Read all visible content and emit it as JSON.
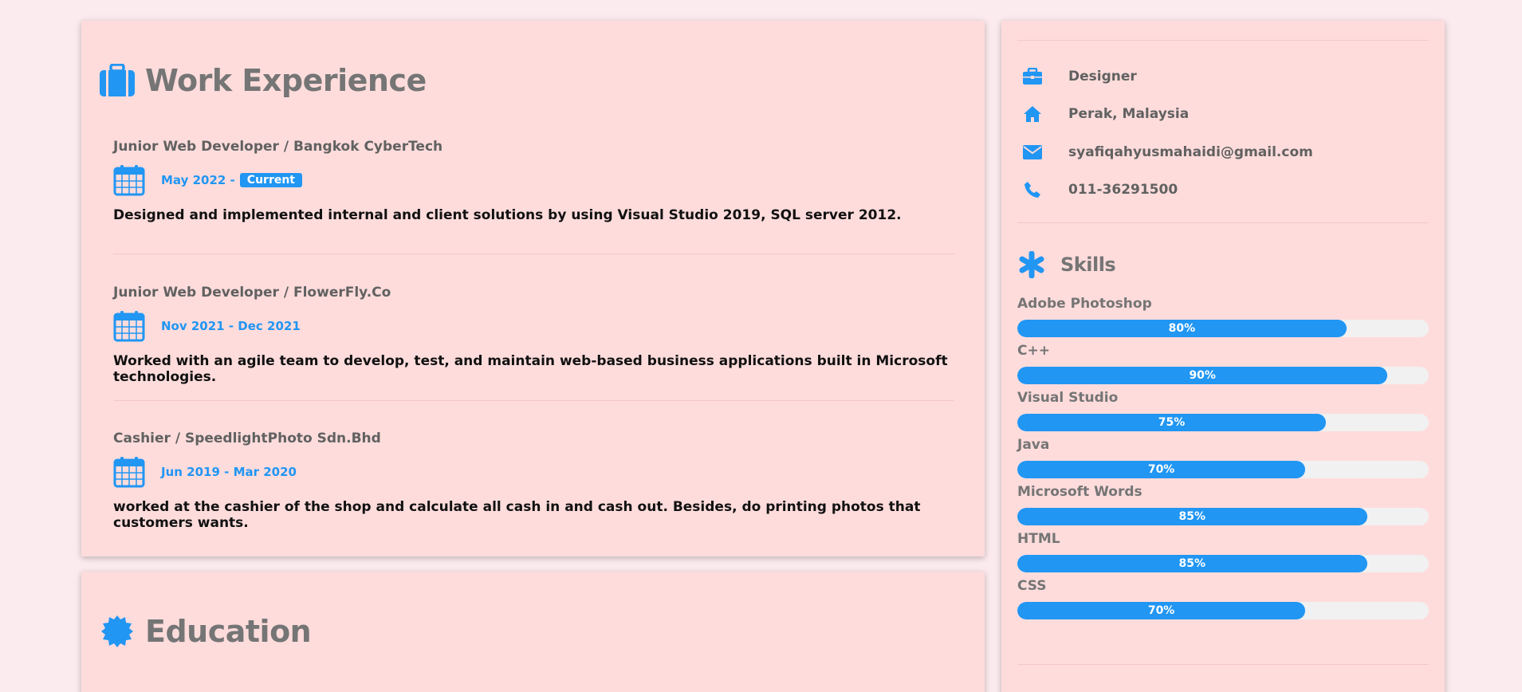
{
  "work": {
    "title": "Work Experience",
    "jobs": [
      {
        "title": "Junior Web Developer / Bangkok CyberTech",
        "date": "May 2022 -",
        "badge": "Current",
        "desc": "Designed and implemented internal and client solutions by using Visual Studio 2019, SQL server 2012."
      },
      {
        "title": "Junior Web Developer / FlowerFly.Co",
        "date": "Nov 2021 - Dec 2021",
        "desc": "Worked with an agile team to develop, test, and maintain web-based business applications built in Microsoft technologies."
      },
      {
        "title": "Cashier / SpeedlightPhoto Sdn.Bhd",
        "date": "Jun 2019 - Mar 2020",
        "desc": "worked at the cashier of the shop and calculate all cash in and cash out. Besides, do printing photos that customers wants."
      }
    ]
  },
  "education": {
    "title": "Education"
  },
  "info": {
    "job": "Designer",
    "location": "Perak, Malaysia",
    "email": "syafiqahyusmahaidi@gmail.com",
    "phone": "011-36291500"
  },
  "skills": {
    "title": "Skills",
    "items": [
      {
        "name": "Adobe Photoshop",
        "percent": 80,
        "label": "80%"
      },
      {
        "name": "C++",
        "percent": 90,
        "label": "90%"
      },
      {
        "name": "Visual Studio",
        "percent": 75,
        "label": "75%"
      },
      {
        "name": "Java",
        "percent": 70,
        "label": "70%"
      },
      {
        "name": "Microsoft Words",
        "percent": 85,
        "label": "85%"
      },
      {
        "name": "HTML",
        "percent": 85,
        "label": "85%"
      },
      {
        "name": "CSS",
        "percent": 70,
        "label": "70%"
      }
    ]
  },
  "colors": {
    "accent": "#2196F3",
    "card": "#ffdcdc",
    "page": "#fbeaee"
  }
}
